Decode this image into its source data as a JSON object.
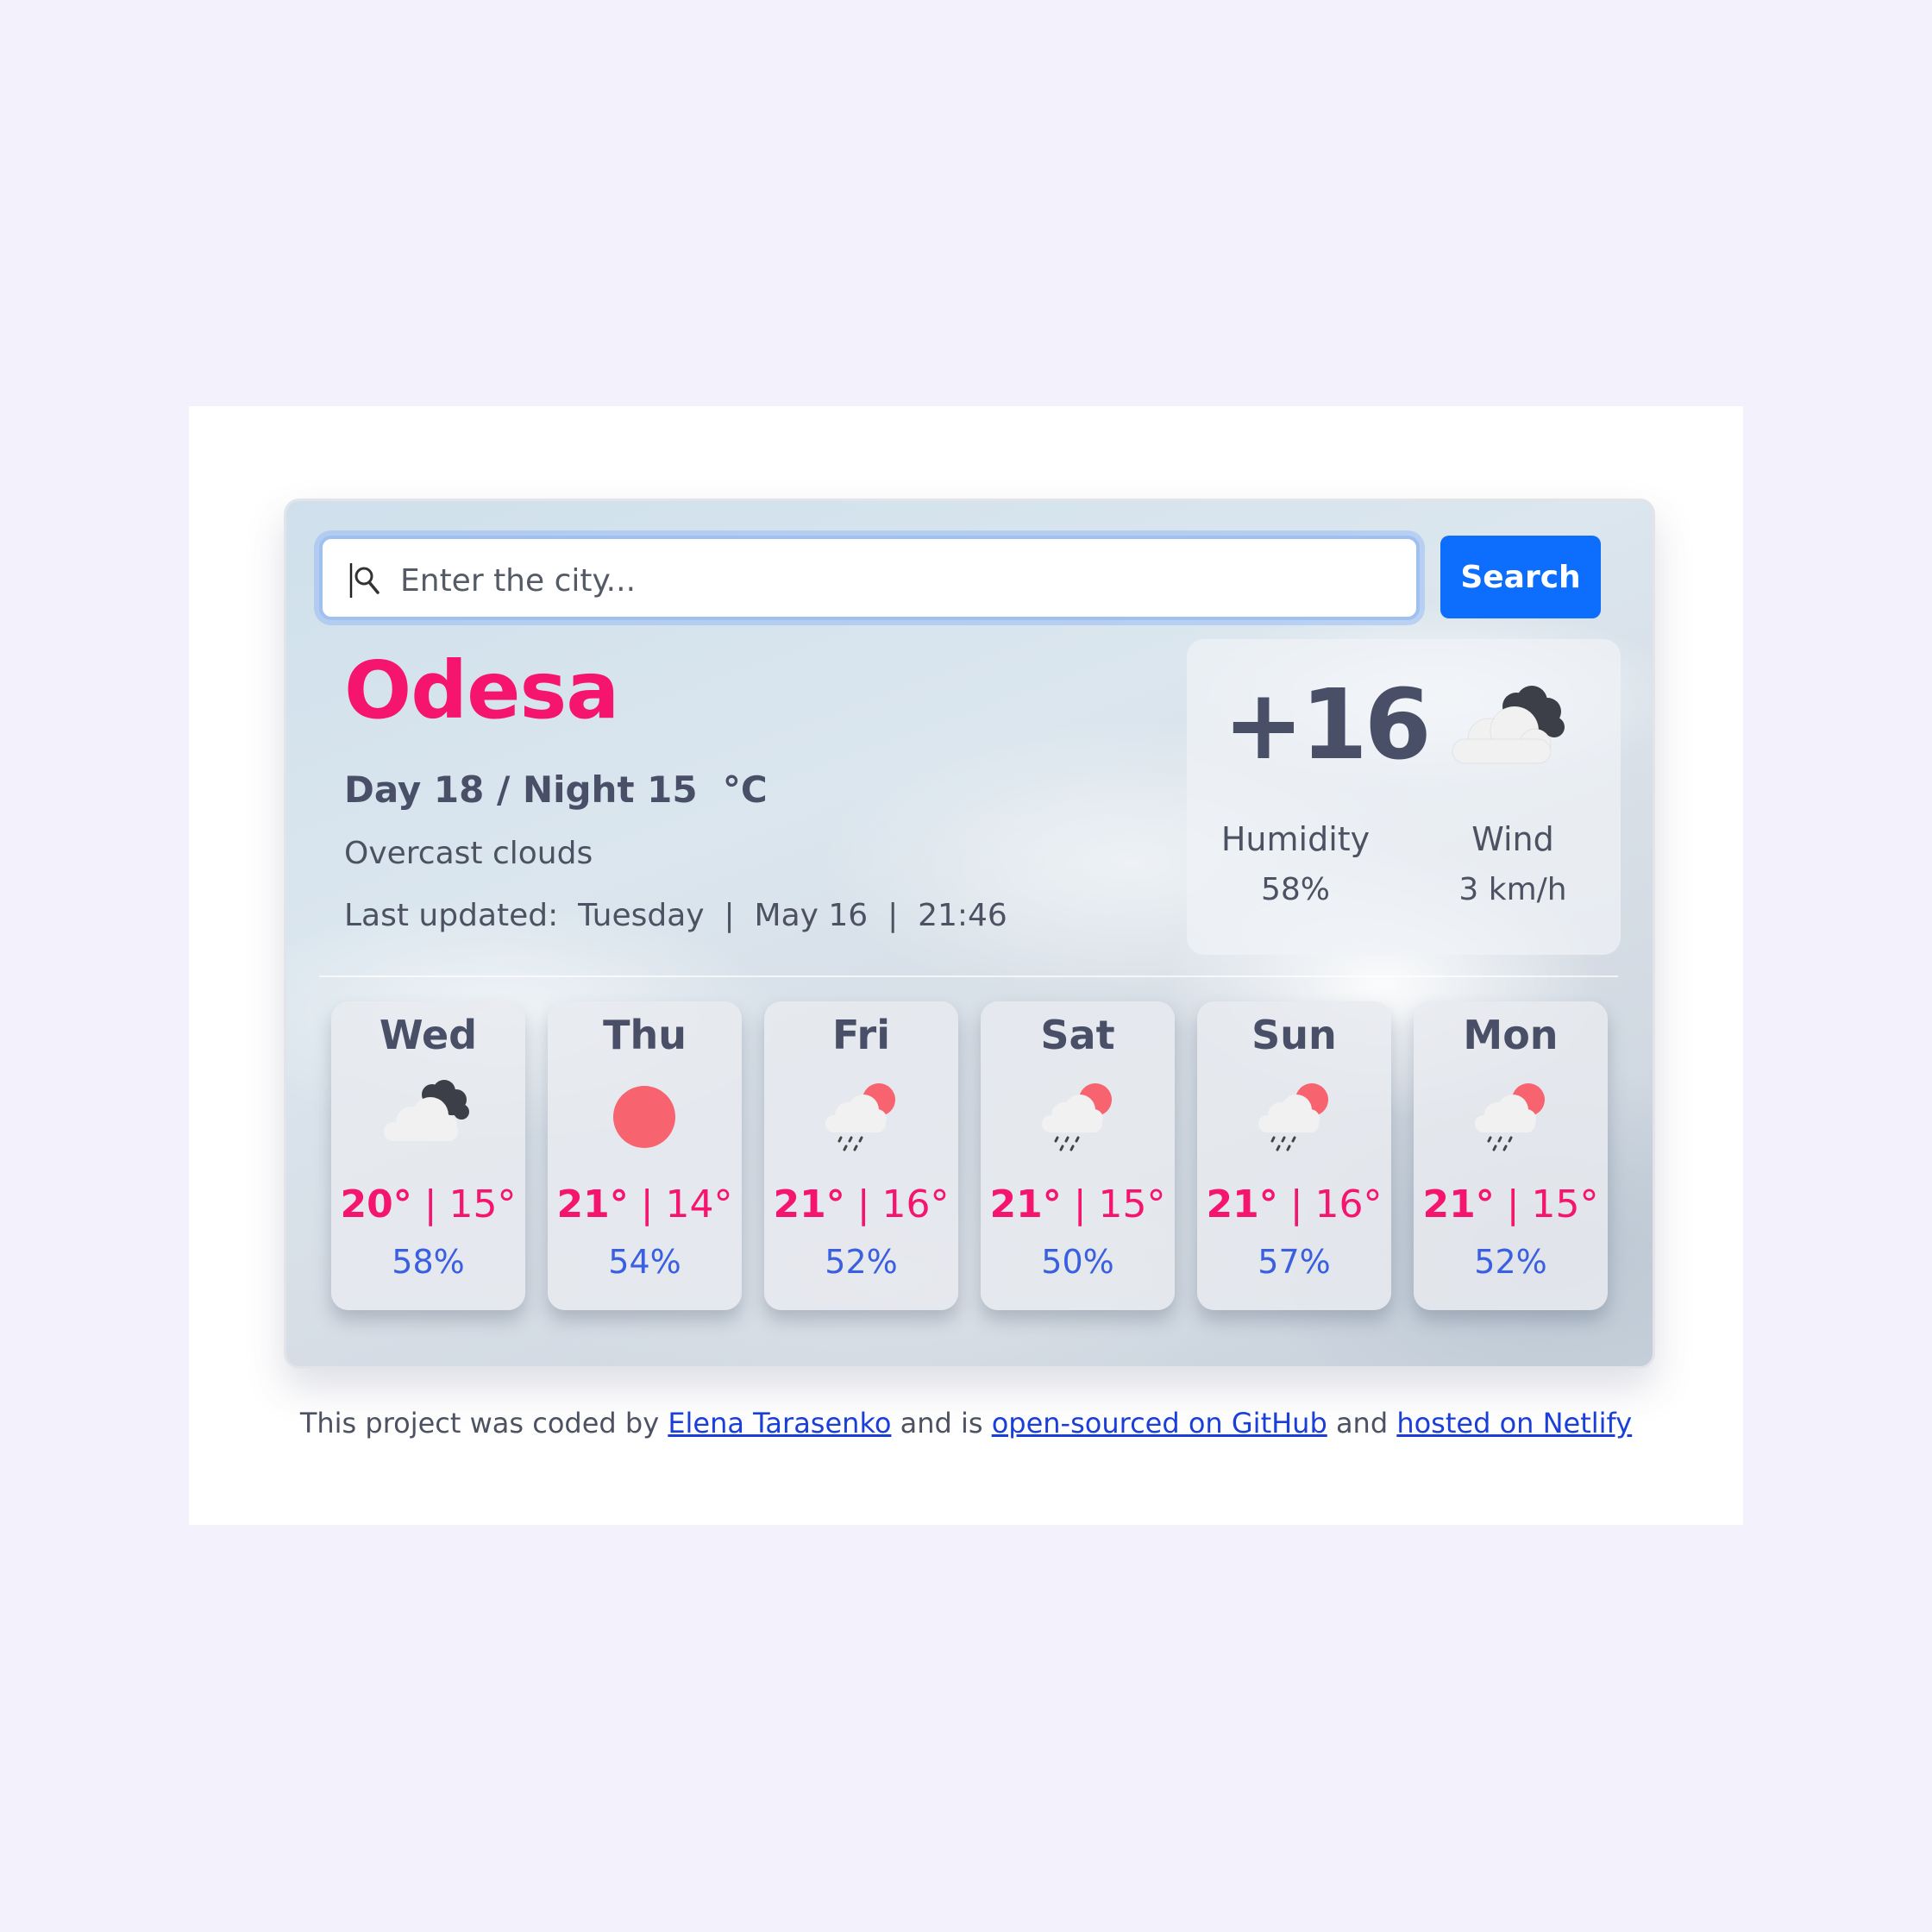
{
  "search": {
    "placeholder": "Enter the city...",
    "button_label": "Search"
  },
  "current": {
    "city": "Odesa",
    "day_night": "Day 18 / Night 15  °C",
    "description": "Overcast clouds",
    "last_updated": "Last updated:  Tuesday  |  May 16  |  21:46",
    "temperature": "+16",
    "icon": "broken-clouds-icon",
    "humidity_label": "Humidity",
    "humidity_value": "58%",
    "wind_label": "Wind",
    "wind_value": "3 km/h"
  },
  "forecast": [
    {
      "day": "Wed",
      "max": "20°",
      "min": "15°",
      "humidity": "58%",
      "icon": "broken-clouds-icon"
    },
    {
      "day": "Thu",
      "max": "21°",
      "min": "14°",
      "humidity": "54%",
      "icon": "clear-sun-icon"
    },
    {
      "day": "Fri",
      "max": "21°",
      "min": "16°",
      "humidity": "52%",
      "icon": "sun-rain-cloud-icon"
    },
    {
      "day": "Sat",
      "max": "21°",
      "min": "15°",
      "humidity": "50%",
      "icon": "sun-rain-cloud-icon"
    },
    {
      "day": "Sun",
      "max": "21°",
      "min": "16°",
      "humidity": "57%",
      "icon": "sun-rain-cloud-icon"
    },
    {
      "day": "Mon",
      "max": "21°",
      "min": "15°",
      "humidity": "52%",
      "icon": "sun-rain-cloud-icon"
    }
  ],
  "footer": {
    "text_1": "This project was coded by ",
    "link_author": "Elena Tarasenko",
    "text_2": " and is ",
    "link_github": "open-sourced on GitHub",
    "text_3": " and ",
    "link_netlify": "hosted on Netlify"
  },
  "colors": {
    "accent": "#f5146e",
    "button": "#0d6efd",
    "humidity_text": "#3a5fe0",
    "sun": "#f7636e"
  }
}
